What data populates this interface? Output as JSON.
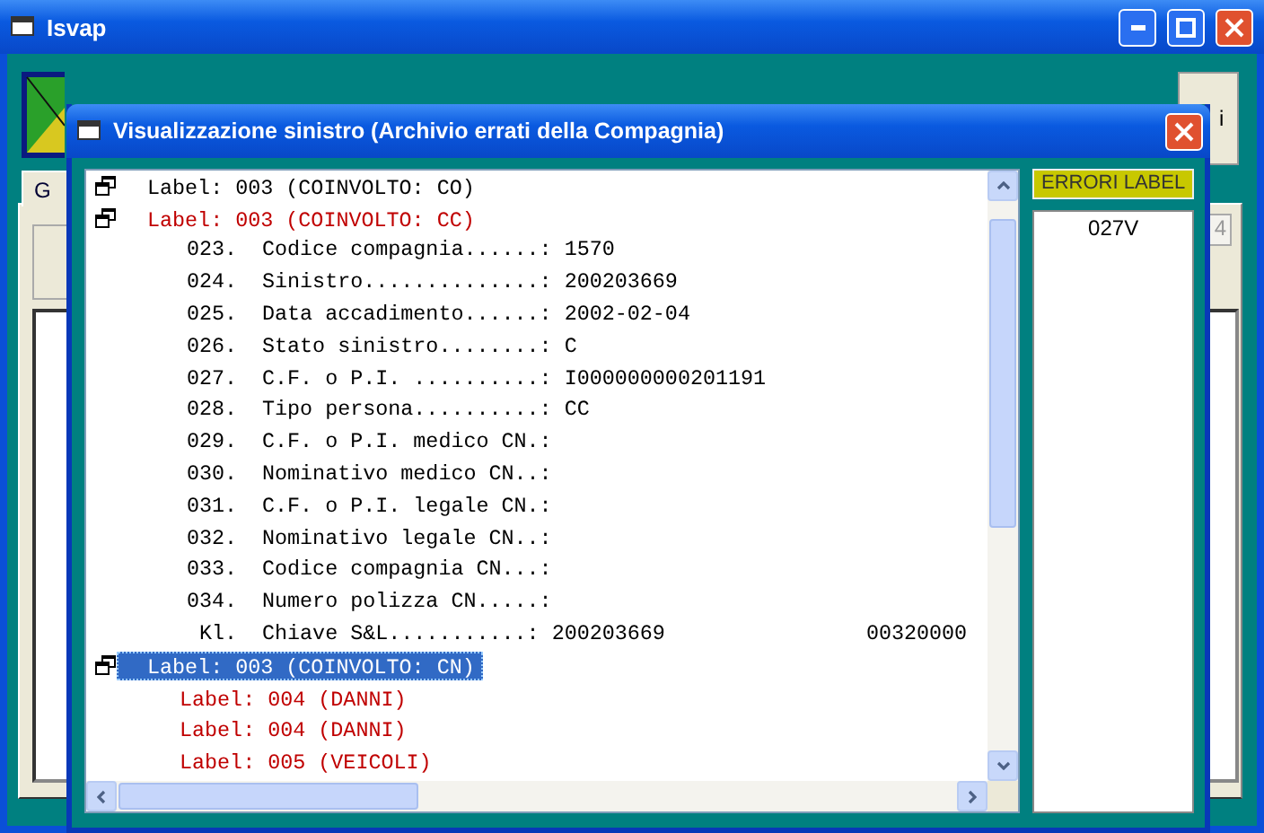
{
  "window": {
    "title": "Isvap",
    "tab_label": "G",
    "button_label": "i",
    "field_value": "4"
  },
  "dialog": {
    "title": "Visualizzazione sinistro (Archivio errati della Compagnia)",
    "tree": [
      {
        "kind": "group",
        "label": "Label: 003 (COINVOLTO: CO)",
        "error": false,
        "selected": false
      },
      {
        "kind": "group",
        "label": "Label: 003 (COINVOLTO: CC)",
        "error": true,
        "selected": false,
        "children": [
          {
            "kind": "field",
            "code": "023.",
            "name": "Codice compagnia......:",
            "value": "1570"
          },
          {
            "kind": "field",
            "code": "024.",
            "name": "Sinistro..............:",
            "value": "200203669"
          },
          {
            "kind": "field",
            "code": "025.",
            "name": "Data accadimento......:",
            "value": "2002-02-04"
          },
          {
            "kind": "field",
            "code": "026.",
            "name": "Stato sinistro........:",
            "value": "C"
          },
          {
            "kind": "field",
            "code": "027.",
            "name": "C.F. o P.I. ..........:",
            "value": "I000000000201191"
          },
          {
            "kind": "field",
            "code": "028.",
            "name": "Tipo persona..........:",
            "value": "CC"
          },
          {
            "kind": "field",
            "code": "029.",
            "name": "C.F. o P.I. medico CN.:"
          },
          {
            "kind": "field",
            "code": "030.",
            "name": "Nominativo medico CN..:"
          },
          {
            "kind": "field",
            "code": "031.",
            "name": "C.F. o P.I. legale CN.:"
          },
          {
            "kind": "field",
            "code": "032.",
            "name": "Nominativo legale CN..:"
          },
          {
            "kind": "field",
            "code": "033.",
            "name": "Codice compagnia CN...:"
          },
          {
            "kind": "field",
            "code": "034.",
            "name": "Numero polizza CN.....:"
          },
          {
            "kind": "field",
            "code": "Kl.",
            "name": "Chiave S&L...........:",
            "value": "200203669",
            "extra": "00320000"
          }
        ]
      },
      {
        "kind": "group",
        "label": "Label: 003 (COINVOLTO: CN)",
        "error": false,
        "selected": true,
        "children": [
          {
            "kind": "label",
            "label": "Label: 004 (DANNI)",
            "error": true,
            "selected": false
          },
          {
            "kind": "label",
            "label": "Label: 004 (DANNI)",
            "error": true,
            "selected": false
          },
          {
            "kind": "label",
            "label": "Label: 005 (VEICOLI)",
            "error": true,
            "selected": false
          }
        ]
      }
    ],
    "errors_title": "ERRORI LABEL",
    "errors": [
      "027V"
    ]
  }
}
